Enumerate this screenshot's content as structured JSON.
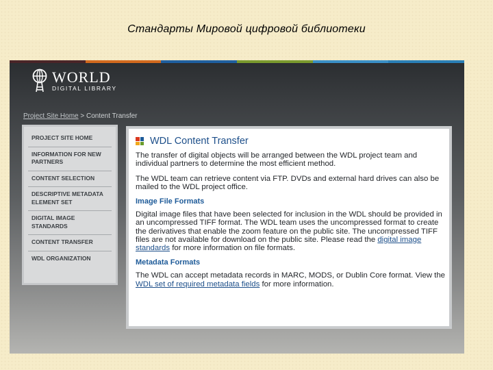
{
  "slide": {
    "title": "Стандарты  Мировой цифровой библиотеки"
  },
  "colors": {
    "stripes": [
      "#4a2528",
      "#d2691e",
      "#1f5fa0",
      "#7a9a2e",
      "#3a8fc6",
      "#2a7fb6"
    ],
    "link": "#1d4f8a",
    "grid_icon": [
      "#d9381e",
      "#1d5a98",
      "#f0a81c",
      "#6b9c2a"
    ]
  },
  "logo": {
    "world": "WORLD",
    "sub": "DIGITAL LIBRARY",
    "icon": "globe-tower-icon"
  },
  "breadcrumb": {
    "home": "Project Site Home",
    "separator": " > ",
    "current": "Content Transfer"
  },
  "sidebar": {
    "items": [
      {
        "label": "PROJECT SITE HOME"
      },
      {
        "label": "INFORMATION FOR NEW PARTNERS"
      },
      {
        "label": "CONTENT SELECTION"
      },
      {
        "label": "DESCRIPTIVE METADATA ELEMENT SET"
      },
      {
        "label": "DIGITAL IMAGE STANDARDS"
      },
      {
        "label": "CONTENT TRANSFER"
      },
      {
        "label": "WDL ORGANIZATION"
      }
    ]
  },
  "content": {
    "title": "WDL Content Transfer",
    "para1": "The transfer of digital objects will be arranged between the WDL project team and individual partners to determine the most efficient method.",
    "para2": "The WDL team can retrieve content via FTP. DVDs and external hard drives can also be mailed to the WDL project office.",
    "image_heading": "Image File Formats",
    "image_para_pre": "Digital image files that have been selected for inclusion in the WDL should be provided in an uncompressed TIFF format. The WDL team uses the uncompressed format to create the derivatives that enable the zoom feature on the public site. The uncompressed TIFF files are not available for download on the public site. Please read the ",
    "image_link": "digital image standards",
    "image_para_post": " for more information on file formats.",
    "meta_heading": "Metadata Formats",
    "meta_para_pre": "The WDL can accept metadata records in MARC, MODS, or Dublin Core format. View the ",
    "meta_link": "WDL set of required metadata fields",
    "meta_para_post": " for more information."
  }
}
